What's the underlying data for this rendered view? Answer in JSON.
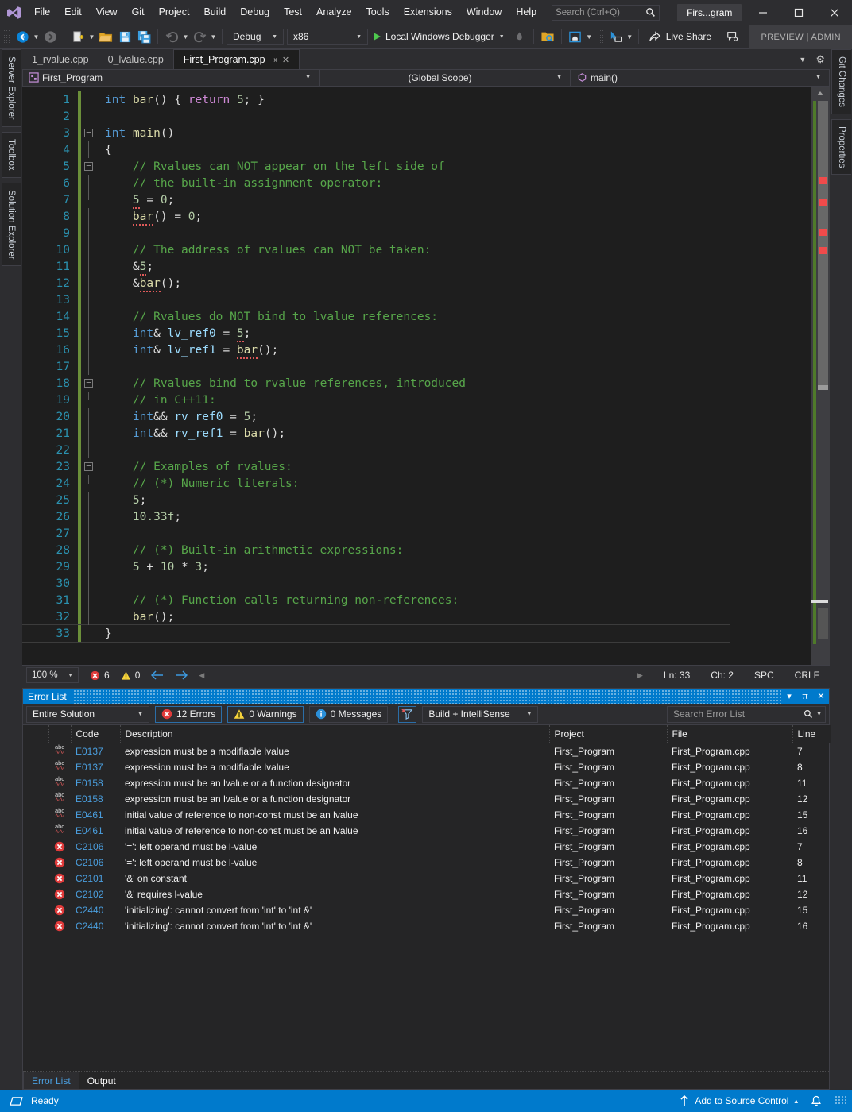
{
  "app": {
    "logo_icon": "visual-studio-logo",
    "solution_name": "Firs...gram",
    "preview_admin": "PREVIEW | ADMIN"
  },
  "menu": {
    "items": [
      {
        "label": "File"
      },
      {
        "label": "Edit"
      },
      {
        "label": "View"
      },
      {
        "label": "Git"
      },
      {
        "label": "Project"
      },
      {
        "label": "Build"
      },
      {
        "label": "Debug"
      },
      {
        "label": "Test"
      },
      {
        "label": "Analyze"
      },
      {
        "label": "Tools"
      },
      {
        "label": "Extensions"
      },
      {
        "label": "Window"
      },
      {
        "label": "Help"
      }
    ]
  },
  "search": {
    "placeholder": "Search (Ctrl+Q)",
    "icon": "search-icon"
  },
  "window_controls": {
    "minimize": "–",
    "maximize": "☐",
    "close": "✕"
  },
  "toolbar": {
    "back_icon": "navigate-back-icon",
    "forward_icon": "navigate-forward-icon",
    "new_item_icon": "new-item-icon",
    "open_icon": "open-file-icon",
    "save_icon": "save-icon",
    "save_all_icon": "save-all-icon",
    "undo_icon": "undo-icon",
    "redo_icon": "redo-icon",
    "config": "Debug",
    "platform": "x86",
    "run_label": "Local Windows Debugger",
    "hot_reload_icon": "hot-reload-icon",
    "folder_search_icon": "folder-search-icon",
    "live_share_label": "Live Share",
    "live_share_icon": "live-share-icon",
    "feedback_icon": "feedback-icon"
  },
  "dock_left": {
    "items": [
      {
        "label": "Server Explorer"
      },
      {
        "label": "Toolbox"
      },
      {
        "label": "Solution Explorer"
      }
    ]
  },
  "dock_right": {
    "items": [
      {
        "label": "Git Changes"
      },
      {
        "label": "Properties"
      }
    ]
  },
  "editor": {
    "tabs": [
      {
        "label": "1_rvalue.cpp",
        "active": false
      },
      {
        "label": "0_lvalue.cpp",
        "active": false
      },
      {
        "label": "First_Program.cpp",
        "active": true
      }
    ],
    "tab_pin_icon": "pin-icon",
    "tab_close_icon": "close-icon",
    "navbar": {
      "project_icon": "cpp-project-icon",
      "project": "First_Program",
      "scope": "(Global Scope)",
      "member_icon": "method-icon",
      "member": "main()"
    },
    "status": {
      "zoom": "100 %",
      "error_count": "6",
      "warning_count": "0",
      "prev_icon": "arrow-left-icon",
      "next_icon": "arrow-right-icon",
      "line": "Ln: 33",
      "column": "Ch: 2",
      "spaces": "SPC",
      "line_endings": "CRLF"
    },
    "lines": [
      {
        "n": 1,
        "fold": "none",
        "text": "int bar() { return 5; }"
      },
      {
        "n": 2,
        "fold": "none",
        "text": ""
      },
      {
        "n": 3,
        "fold": "minus",
        "text": "int main()"
      },
      {
        "n": 4,
        "fold": "bar",
        "text": "{"
      },
      {
        "n": 5,
        "fold": "minus",
        "text": "    // Rvalues can NOT appear on the left side of"
      },
      {
        "n": 6,
        "fold": "bar",
        "text": "    // the built-in assignment operator:"
      },
      {
        "n": 7,
        "fold": "end",
        "text": "    5 = 0;"
      },
      {
        "n": 8,
        "fold": "bar",
        "text": "    bar() = 0;"
      },
      {
        "n": 9,
        "fold": "bar",
        "text": ""
      },
      {
        "n": 10,
        "fold": "bar",
        "text": "    // The address of rvalues can NOT be taken:"
      },
      {
        "n": 11,
        "fold": "bar",
        "text": "    &5;"
      },
      {
        "n": 12,
        "fold": "bar",
        "text": "    &bar();"
      },
      {
        "n": 13,
        "fold": "bar",
        "text": ""
      },
      {
        "n": 14,
        "fold": "bar",
        "text": "    // Rvalues do NOT bind to lvalue references:"
      },
      {
        "n": 15,
        "fold": "bar",
        "text": "    int& lv_ref0 = 5;"
      },
      {
        "n": 16,
        "fold": "bar",
        "text": "    int& lv_ref1 = bar();"
      },
      {
        "n": 17,
        "fold": "bar",
        "text": ""
      },
      {
        "n": 18,
        "fold": "minus",
        "text": "    // Rvalues bind to rvalue references, introduced"
      },
      {
        "n": 19,
        "fold": "end",
        "text": "    // in C++11:"
      },
      {
        "n": 20,
        "fold": "bar",
        "text": "    int&& rv_ref0 = 5;"
      },
      {
        "n": 21,
        "fold": "bar",
        "text": "    int&& rv_ref1 = bar();"
      },
      {
        "n": 22,
        "fold": "bar",
        "text": ""
      },
      {
        "n": 23,
        "fold": "minus",
        "text": "    // Examples of rvalues:"
      },
      {
        "n": 24,
        "fold": "end",
        "text": "    // (*) Numeric literals:"
      },
      {
        "n": 25,
        "fold": "bar",
        "text": "    5;"
      },
      {
        "n": 26,
        "fold": "bar",
        "text": "    10.33f;"
      },
      {
        "n": 27,
        "fold": "bar",
        "text": ""
      },
      {
        "n": 28,
        "fold": "bar",
        "text": "    // (*) Built-in arithmetic expressions:"
      },
      {
        "n": 29,
        "fold": "bar",
        "text": "    5 + 10 * 3;"
      },
      {
        "n": 30,
        "fold": "bar",
        "text": ""
      },
      {
        "n": 31,
        "fold": "bar",
        "text": "    // (*) Function calls returning non-references:"
      },
      {
        "n": 32,
        "fold": "bar",
        "text": "    bar();"
      },
      {
        "n": 33,
        "fold": "none",
        "text": "}"
      }
    ]
  },
  "error_list": {
    "title": "Error List",
    "panel_controls": {
      "dropdown": "▾",
      "pin": "π",
      "close": "✕"
    },
    "scope": "Entire Solution",
    "errors_label": "12 Errors",
    "warnings_label": "0 Warnings",
    "messages_label": "0 Messages",
    "filter_icon": "clear-filter-icon",
    "build_filter": "Build + IntelliSense",
    "search_placeholder": "Search Error List",
    "search_icon": "search-icon",
    "columns": [
      "",
      "",
      "Code",
      "Description",
      "Project",
      "File",
      "Line"
    ],
    "rows": [
      {
        "icon": "intellisense-icon",
        "code": "E0137",
        "description": "expression must be a modifiable lvalue",
        "project": "First_Program",
        "file": "First_Program.cpp",
        "line": "7"
      },
      {
        "icon": "intellisense-icon",
        "code": "E0137",
        "description": "expression must be a modifiable lvalue",
        "project": "First_Program",
        "file": "First_Program.cpp",
        "line": "8"
      },
      {
        "icon": "intellisense-icon",
        "code": "E0158",
        "description": "expression must be an lvalue or a function designator",
        "project": "First_Program",
        "file": "First_Program.cpp",
        "line": "11"
      },
      {
        "icon": "intellisense-icon",
        "code": "E0158",
        "description": "expression must be an lvalue or a function designator",
        "project": "First_Program",
        "file": "First_Program.cpp",
        "line": "12"
      },
      {
        "icon": "intellisense-icon",
        "code": "E0461",
        "description": "initial value of reference to non-const must be an lvalue",
        "project": "First_Program",
        "file": "First_Program.cpp",
        "line": "15"
      },
      {
        "icon": "intellisense-icon",
        "code": "E0461",
        "description": "initial value of reference to non-const must be an lvalue",
        "project": "First_Program",
        "file": "First_Program.cpp",
        "line": "16"
      },
      {
        "icon": "error-icon",
        "code": "C2106",
        "description": "'=': left operand must be l-value",
        "project": "First_Program",
        "file": "First_Program.cpp",
        "line": "7"
      },
      {
        "icon": "error-icon",
        "code": "C2106",
        "description": "'=': left operand must be l-value",
        "project": "First_Program",
        "file": "First_Program.cpp",
        "line": "8"
      },
      {
        "icon": "error-icon",
        "code": "C2101",
        "description": "'&' on constant",
        "project": "First_Program",
        "file": "First_Program.cpp",
        "line": "11"
      },
      {
        "icon": "error-icon",
        "code": "C2102",
        "description": "'&' requires l-value",
        "project": "First_Program",
        "file": "First_Program.cpp",
        "line": "12"
      },
      {
        "icon": "error-icon",
        "code": "C2440",
        "description": "'initializing': cannot convert from 'int' to 'int &'",
        "project": "First_Program",
        "file": "First_Program.cpp",
        "line": "15"
      },
      {
        "icon": "error-icon",
        "code": "C2440",
        "description": "'initializing': cannot convert from 'int' to 'int &'",
        "project": "First_Program",
        "file": "First_Program.cpp",
        "line": "16"
      }
    ],
    "tabs": [
      {
        "label": "Error List",
        "active": true
      },
      {
        "label": "Output",
        "active": false
      }
    ]
  },
  "statusbar": {
    "ready": "Ready",
    "ready_icon": "status-shape-icon",
    "source_control": "Add to Source Control",
    "source_control_icon": "upload-arrow-icon",
    "source_control_caret": "▴",
    "notification_icon": "bell-icon",
    "color": "#007acc"
  }
}
